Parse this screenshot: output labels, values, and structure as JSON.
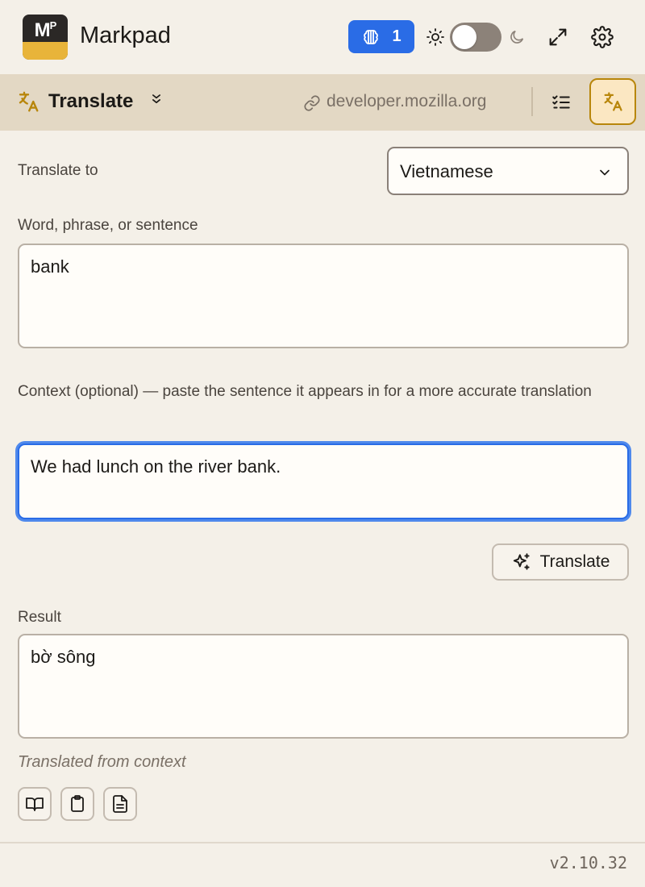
{
  "app": {
    "title": "Markpad",
    "logo_text": "M",
    "logo_sup": "P",
    "ai_badge_count": "1"
  },
  "colors": {
    "accent_blue": "#2a6ce6",
    "toolbar_bg": "#e3d8c4",
    "page_bg": "#f4f0e8",
    "active_tool_border": "#b8860b",
    "logo_yellow": "#e8b43a"
  },
  "icons": {
    "ai": "brain-icon",
    "theme_light": "sun-icon",
    "theme_dark": "moon-icon",
    "fullscreen": "expand-icon",
    "settings": "gear-icon",
    "tool": "translate-icon",
    "tool_menu": "chevron-down-icon",
    "source_link": "link-icon",
    "checklist": "checklist-icon",
    "sparkle": "sparkle-icon",
    "dictionary": "book-icon",
    "copy": "clipboard-icon",
    "insert_note": "document-icon"
  },
  "toolbar": {
    "title": "Translate",
    "domain": "developer.mozilla.org"
  },
  "form": {
    "translate_to_label": "Translate to",
    "language_selected": "Vietnamese",
    "word_label": "Word, phrase, or sentence",
    "word_value": "bank",
    "context_label": "Context (optional) — paste the sentence it appears in for a more accurate translation",
    "context_value": "We had lunch on the river bank.",
    "translate_button": "Translate",
    "result_label": "Result",
    "result_value": "bờ sông",
    "result_note": "Translated from context"
  },
  "footer": {
    "version": "v2.10.32"
  }
}
